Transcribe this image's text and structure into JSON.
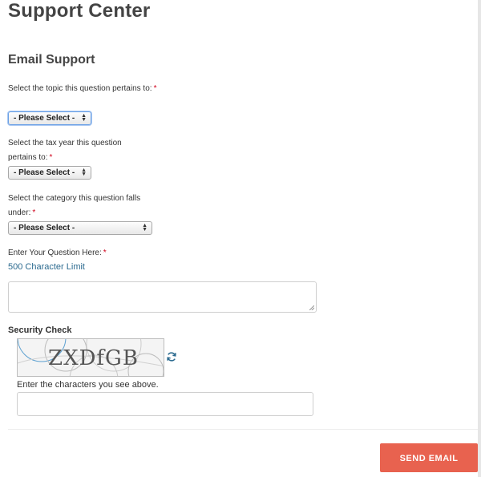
{
  "page": {
    "title": "Support Center"
  },
  "section": {
    "title": "Email Support"
  },
  "form": {
    "topic": {
      "label": "Select the topic this question pertains to:",
      "required": "*",
      "selected": "- Please Select -"
    },
    "tax_year": {
      "label": "Select the tax year this question pertains to:",
      "required": "*",
      "selected": "- Please Select -"
    },
    "category": {
      "label": "Select the category this question falls under:",
      "required": "*",
      "selected": "- Please Select -"
    },
    "question": {
      "label": "Enter Your Question Here:",
      "required": "*",
      "limit_note": "500 Character Limit",
      "value": ""
    }
  },
  "security": {
    "title": "Security Check",
    "captcha_text": "ZXDfGB",
    "hint": "Enter the characters you see above.",
    "value": "",
    "refresh_icon": "refresh-icon"
  },
  "actions": {
    "send_label": "SEND EMAIL"
  },
  "colors": {
    "accent": "#e8624f",
    "link": "#2b6a8f",
    "required": "#d0021b",
    "focus": "#6aa0e6"
  }
}
